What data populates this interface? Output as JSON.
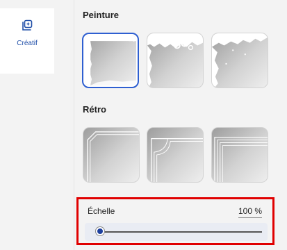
{
  "sidebar": {
    "items": [
      {
        "label": "Créatif",
        "icon": "sparkle-frame-icon"
      }
    ]
  },
  "panel": {
    "sections": [
      {
        "title": "Peinture",
        "thumbnails": [
          {
            "name": "paint-frame-1",
            "selected": true
          },
          {
            "name": "paint-frame-2",
            "selected": false
          },
          {
            "name": "paint-frame-3",
            "selected": false
          }
        ]
      },
      {
        "title": "Rétro",
        "thumbnails": [
          {
            "name": "retro-frame-1",
            "selected": false
          },
          {
            "name": "retro-frame-2",
            "selected": false
          },
          {
            "name": "retro-frame-3",
            "selected": false
          }
        ]
      }
    ],
    "scale": {
      "label": "Échelle",
      "value_text": "100 %",
      "value": 100
    }
  },
  "colors": {
    "accent": "#2e5fd1",
    "highlight_border": "#e00000",
    "slider_thumb": "#1c3f9e"
  }
}
